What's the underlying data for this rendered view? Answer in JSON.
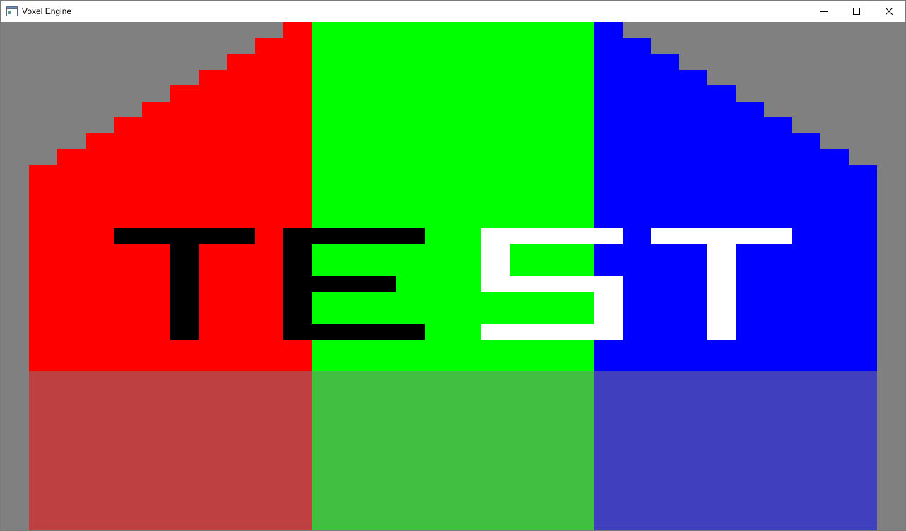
{
  "window": {
    "title": "Voxel Engine",
    "controls": [
      "minimize-icon",
      "maximize-icon",
      "close-icon"
    ]
  },
  "scene": {
    "background_color": "#808080",
    "upper_colors": {
      "left": "#ff0000",
      "center": "#00ff00",
      "right": "#0000ff"
    },
    "lower_colors": {
      "left": "#bf4040",
      "center": "#40bf40",
      "right": "#4040bf"
    },
    "text_glyphs": [
      {
        "char": "T",
        "color": "#000000"
      },
      {
        "char": "E",
        "color": "#000000"
      },
      {
        "char": "S",
        "color": "#ffffff"
      },
      {
        "char": "T",
        "color": "#ffffff"
      }
    ]
  }
}
